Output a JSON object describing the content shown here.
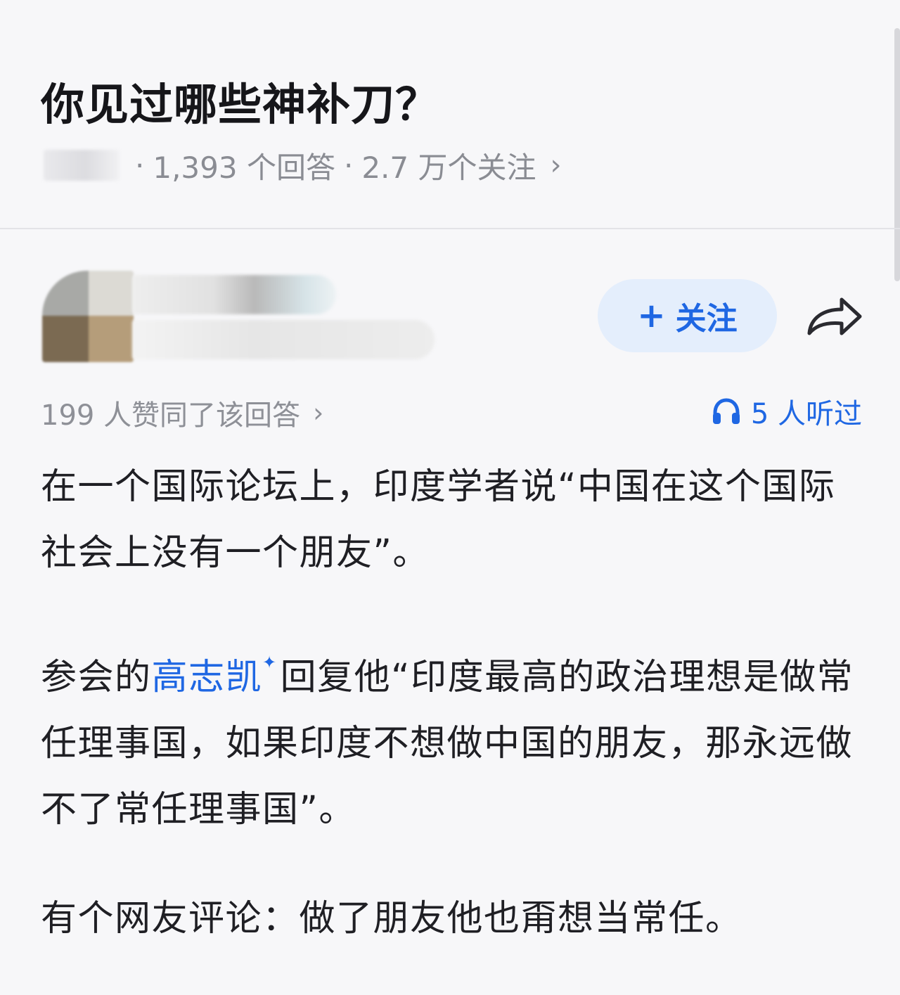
{
  "question": {
    "title": "你见过哪些神补刀？",
    "answers_count": "1,393 个回答",
    "followers_count": "2.7 万个关注",
    "separator": "·",
    "chevron": "›"
  },
  "author": {
    "follow_label": "关注",
    "follow_plus": "+",
    "share_icon": "share-arrow-icon"
  },
  "stats": {
    "votes": "199 人赞同了该回答",
    "votes_chevron": "›",
    "listened": "5 人听过",
    "listened_icon": "headphones-icon"
  },
  "answer": {
    "p1": "在一个国际论坛上，印度学者说“中国在这个国际社会上没有一个朋友”。",
    "p2_before": "参会的",
    "p2_link": "高志凯",
    "p2_spark": "✦",
    "p2_after": "回复他“印度最高的政治理想是做常任理事国，如果印度不想做中国的朋友，那永远做不了常任理事国”。",
    "p3": "有个网友评论：做了朋友他也甭想当常任。"
  },
  "colors": {
    "accent": "#1f67e3",
    "follow_bg": "#e4eefc",
    "meta_text": "#8a8c93",
    "body_text": "#1f1f24",
    "background": "#f7f7f9"
  }
}
